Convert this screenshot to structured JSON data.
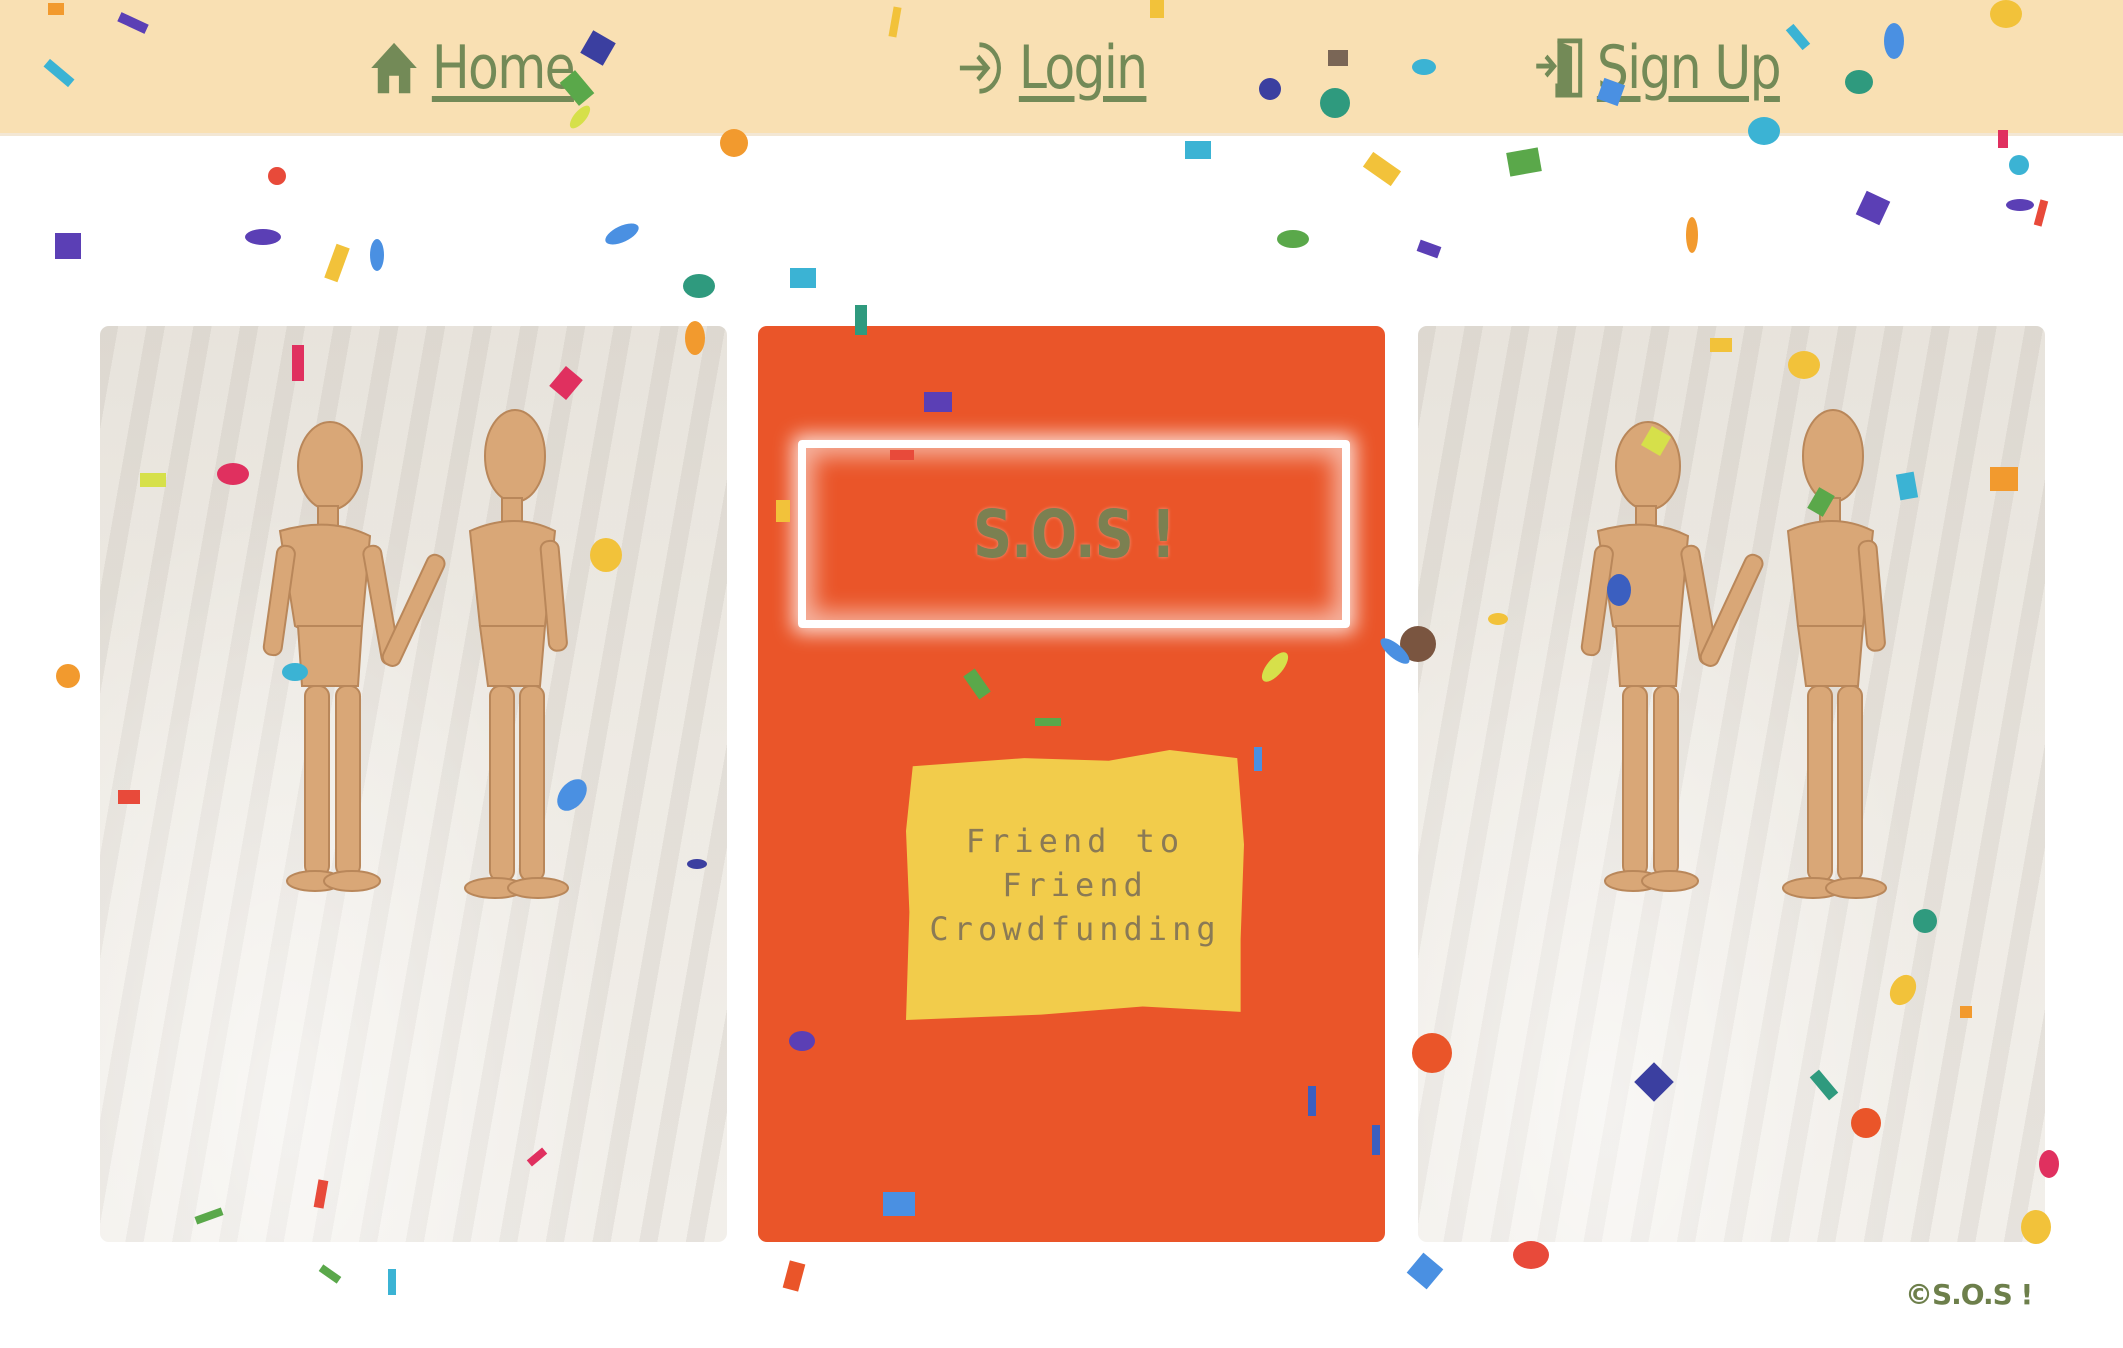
{
  "nav": {
    "home_label": "Home",
    "login_label": "Login",
    "signup_label": "Sign Up"
  },
  "hero": {
    "brand_title": "S.O.S !",
    "tagline_line1": "Friend to Friend",
    "tagline_line2": "Crowdfunding"
  },
  "footer": {
    "copyright": "©S.O.S !"
  },
  "colors": {
    "nav_bg": "#f9e0b3",
    "nav_text": "#738a57",
    "accent_orange": "#ea5529",
    "note_yellow": "#f2cc4b",
    "title_olive": "#7b8051"
  },
  "icons": {
    "home": "home-icon",
    "login": "sign-in-icon",
    "signup": "door-enter-icon"
  }
}
